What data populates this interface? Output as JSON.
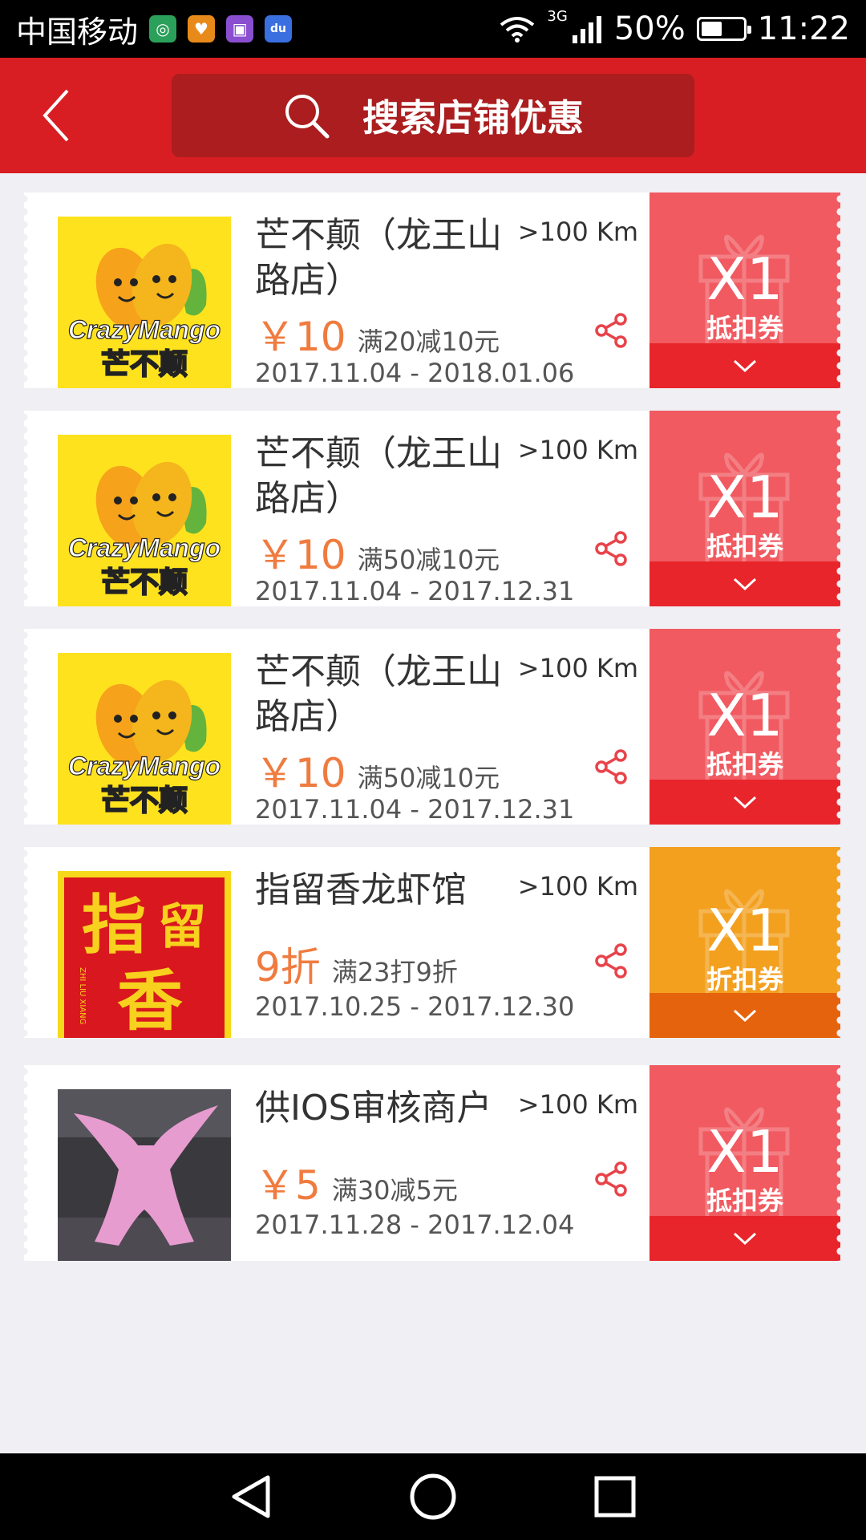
{
  "status_bar": {
    "carrier": "中国移动",
    "network": "3G",
    "battery": "50%",
    "time": "11:22",
    "battery_level": 0.5
  },
  "header": {
    "search_label": "搜索店铺优惠"
  },
  "coupons": [
    {
      "shop": "芒不颠（龙王山路店）",
      "distance": ">100 Km",
      "price": "￥10",
      "rule": "满20减10元",
      "date": "2017.11.04 - 2018.01.06",
      "count": "X1",
      "type": "抵扣券",
      "theme": "red",
      "logo_text": "CrazyMango",
      "logo_sub": "芒不颠"
    },
    {
      "shop": "芒不颠（龙王山路店）",
      "distance": ">100 Km",
      "price": "￥10",
      "rule": "满50减10元",
      "date": "2017.11.04 - 2017.12.31",
      "count": "X1",
      "type": "抵扣券",
      "theme": "red",
      "logo_text": "CrazyMango",
      "logo_sub": "芒不颠"
    },
    {
      "shop": "芒不颠（龙王山路店）",
      "distance": ">100 Km",
      "price": "￥10",
      "rule": "满50减10元",
      "date": "2017.11.04 - 2017.12.31",
      "count": "X1",
      "type": "抵扣券",
      "theme": "red",
      "logo_text": "CrazyMango",
      "logo_sub": "芒不颠"
    },
    {
      "shop": "指留香龙虾馆",
      "distance": ">100 Km",
      "price": "9折",
      "rule": "满23打9折",
      "date": "2017.10.25 - 2017.12.30",
      "count": "X1",
      "type": "折扣券",
      "theme": "orange",
      "logo_text": "指留香",
      "logo_sub": "ZHI LIU XIANG"
    },
    {
      "shop": "供IOS审核商户",
      "distance": ">100 Km",
      "price": "￥5",
      "rule": "满30减5元",
      "date": "2017.11.28 - 2017.12.04",
      "count": "X1",
      "type": "抵扣券",
      "theme": "red",
      "logo_text": "",
      "logo_sub": ""
    }
  ],
  "colors": {
    "header_red": "#d81e22",
    "search_bg": "#ab1d1e",
    "price_orange": "#f07b3f",
    "coupon_red": "#f05a60",
    "coupon_orange": "#f3a01f"
  },
  "icons": {
    "back": "chevron-left-icon",
    "search": "search-icon",
    "share": "share-icon",
    "expand": "chevron-down-icon",
    "gift": "gift-icon"
  }
}
